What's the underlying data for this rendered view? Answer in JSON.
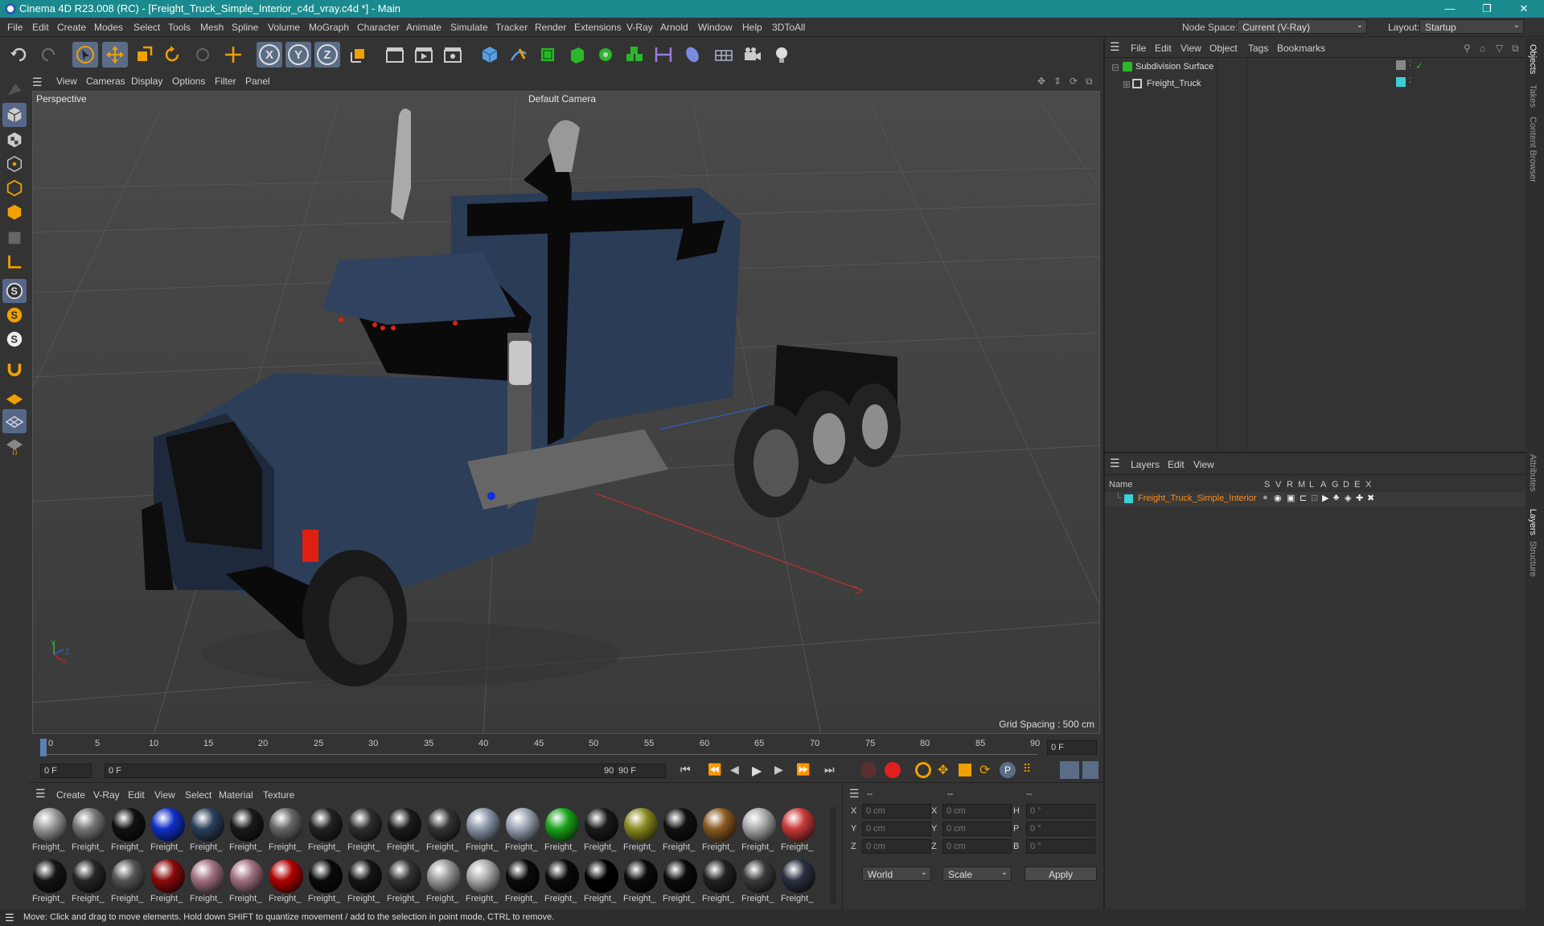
{
  "window": {
    "title": "Cinema 4D R23.008 (RC) - [Freight_Truck_Simple_Interior_c4d_vray.c4d *] - Main",
    "minimize": "—",
    "restore": "❐",
    "close": "✕"
  },
  "menubar": {
    "items": [
      "File",
      "Edit",
      "Create",
      "Modes",
      "Select",
      "Tools",
      "Mesh",
      "Spline",
      "Volume",
      "MoGraph",
      "Character",
      "Animate",
      "Simulate",
      "Tracker",
      "Render",
      "Extensions",
      "V-Ray",
      "Arnold",
      "Window",
      "Help",
      "3DToAll"
    ],
    "node_space_label": "Node Space:",
    "node_space_value": "Current (V-Ray)",
    "layout_label": "Layout:",
    "layout_value": "Startup"
  },
  "toolbar": {
    "axis_x": "X",
    "axis_y": "Y",
    "axis_z": "Z"
  },
  "viewport": {
    "menu": [
      "View",
      "Cameras",
      "Display",
      "Options",
      "Filter",
      "Panel"
    ],
    "label": "Perspective",
    "camera": "Default Camera",
    "grid_spacing": "Grid Spacing : 500 cm",
    "axis_y": "Y",
    "axis_z": "Z",
    "axis_x": "X"
  },
  "timeline": {
    "ticks": [
      "0",
      "5",
      "10",
      "15",
      "20",
      "25",
      "30",
      "35",
      "40",
      "45",
      "50",
      "55",
      "60",
      "65",
      "70",
      "75",
      "80",
      "85",
      "90"
    ],
    "current_frame": "0 F",
    "start_frame": "0 F",
    "range_start": "0 F",
    "range_end": "90 F",
    "end_frame": "90 F"
  },
  "materials": {
    "menu": [
      "Create",
      "V-Ray",
      "Edit",
      "View",
      "Select",
      "Material",
      "Texture"
    ],
    "label": "Freight_",
    "row1_colors": [
      "#9a9a9a",
      "#777",
      "#111",
      "#1030c8",
      "#2b3f5a",
      "#1a1a1a",
      "#666",
      "#222",
      "#2e2e2e",
      "#1c1c1c",
      "#333",
      "#8a95a8",
      "#9aa4b4",
      "#1aa31a",
      "#1a1a1a",
      "#8a8a20",
      "#111",
      "#8a5a20",
      "#aaa",
      "#c83a3a"
    ],
    "row2_colors": [
      "#151515",
      "#262626",
      "#555",
      "#8a0a0a",
      "#a07080",
      "#a07080",
      "#b00000",
      "#0a0a0a",
      "#151515",
      "#333",
      "#999",
      "#aaa",
      "#0a0a0a",
      "#0a0a0a",
      "#000",
      "#0a0a0a",
      "#0a0a0a",
      "#222",
      "#3a3a3a",
      "#2a3040"
    ]
  },
  "attributes": {
    "headers": [
      "--",
      "--",
      "--"
    ],
    "rows": [
      {
        "a": "X",
        "av": "0 cm",
        "b": "X",
        "bv": "0 cm",
        "c": "H",
        "cv": "0 °"
      },
      {
        "a": "Y",
        "av": "0 cm",
        "b": "Y",
        "bv": "0 cm",
        "c": "P",
        "cv": "0 °"
      },
      {
        "a": "Z",
        "av": "0 cm",
        "b": "Z",
        "bv": "0 cm",
        "c": "B",
        "cv": "0 °"
      }
    ],
    "coord_mode": "World",
    "size_mode": "Scale",
    "apply": "Apply"
  },
  "objects": {
    "menu": [
      "File",
      "Edit",
      "View",
      "Object",
      "Tags",
      "Bookmarks"
    ],
    "items": [
      "Subdivision Surface",
      "Freight_Truck"
    ],
    "tag_color": "#3ad0d8"
  },
  "layers": {
    "menu": [
      "Layers",
      "Edit",
      "View"
    ],
    "name_header": "Name",
    "flags": [
      "S",
      "V",
      "R",
      "M",
      "L",
      "A",
      "G",
      "D",
      "E",
      "X"
    ],
    "layer_name": "Freight_Truck_Simple_Interior",
    "layer_color": "#3ad0d8",
    "layer_text_color": "#ff8a1a"
  },
  "sidetabs": [
    "Objects",
    "Takes",
    "Content Browser",
    "Attributes",
    "Layers",
    "Structure"
  ],
  "status": "Move: Click and drag to move elements. Hold down SHIFT to quantize movement / add to the selection in point mode, CTRL to remove."
}
